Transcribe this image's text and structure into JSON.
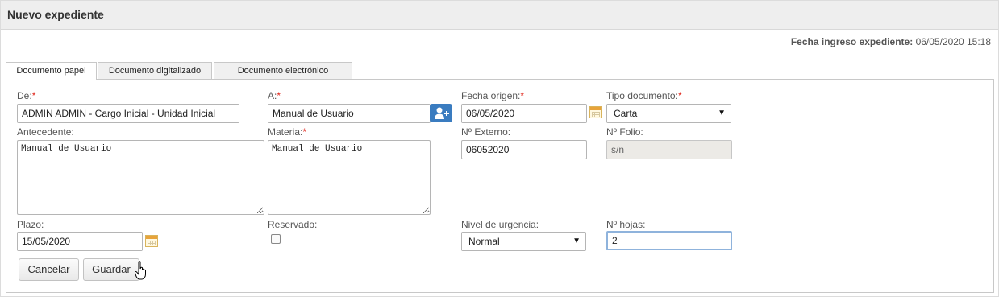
{
  "header": {
    "title": "Nuevo expediente"
  },
  "ingreso": {
    "label": "Fecha ingreso expediente:",
    "value": "06/05/2020 15:18"
  },
  "tabs": [
    {
      "label": "Documento papel",
      "active": true
    },
    {
      "label": "Documento digitalizado",
      "active": false
    },
    {
      "label": "Documento electrónico",
      "active": false
    }
  ],
  "form": {
    "de": {
      "label": "De:",
      "required": "*",
      "value": "ADMIN ADMIN - Cargo Inicial - Unidad Inicial"
    },
    "a": {
      "label": "A:",
      "required": "*",
      "value": "Manual de Usuario"
    },
    "fecha_origen": {
      "label": "Fecha origen:",
      "required": "*",
      "value": "06/05/2020"
    },
    "tipo_documento": {
      "label": "Tipo documento:",
      "required": "*",
      "value": "Carta"
    },
    "antecedente": {
      "label": "Antecedente:",
      "value": "Manual de Usuario"
    },
    "materia": {
      "label": "Materia:",
      "required": "*",
      "value": "Manual de Usuario"
    },
    "n_externo": {
      "label": "Nº Externo:",
      "value": "06052020"
    },
    "n_folio": {
      "label": "Nº Folio:",
      "value": "s/n"
    },
    "plazo": {
      "label": "Plazo:",
      "value": "15/05/2020"
    },
    "reservado": {
      "label": "Reservado:",
      "checked": false
    },
    "nivel_urgencia": {
      "label": "Nivel de urgencia:",
      "value": "Normal"
    },
    "n_hojas": {
      "label": "Nº hojas:",
      "value": "2"
    }
  },
  "buttons": {
    "cancelar": "Cancelar",
    "guardar": "Guardar"
  },
  "icons": {
    "user_add": "user-plus-icon",
    "calendar": "calendar-icon",
    "dropdown": "chevron-down-icon"
  },
  "colors": {
    "required": "#e0261b",
    "user_button": "#3a7cc0",
    "focus_border": "#8fb3dc"
  }
}
